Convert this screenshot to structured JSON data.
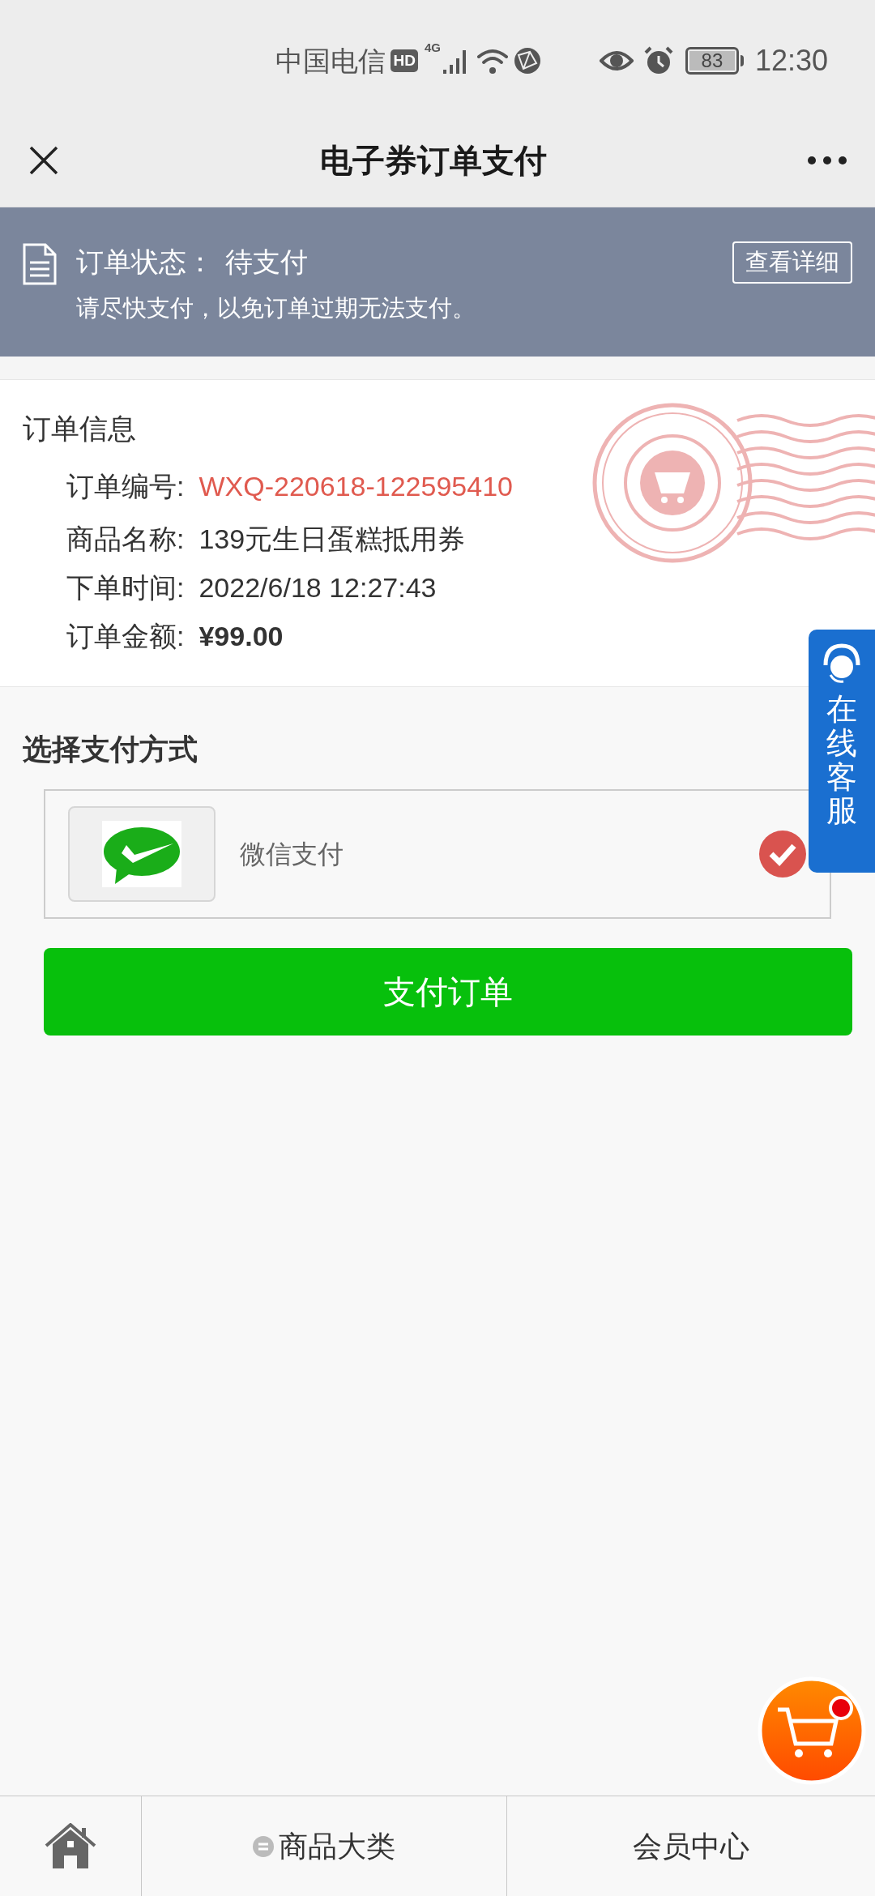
{
  "status_bar": {
    "carrier": "中国电信",
    "hd_badge": "HD",
    "network": "4G",
    "battery": "83",
    "time": "12:30"
  },
  "nav_bar": {
    "title": "电子券订单支付"
  },
  "order_banner": {
    "status_label": "订单状态：",
    "status_value": "待支付",
    "hint": "请尽快支付，以免订单过期无法支付。",
    "detail_button": "查看详细"
  },
  "order_info": {
    "title": "订单信息",
    "fields": [
      {
        "label": "订单编号:",
        "value": "WXQ-220618-122595410",
        "kind": "highlight"
      },
      {
        "label": "商品名称:",
        "value": "139元生日蛋糕抵用券",
        "kind": "plain"
      },
      {
        "label": "下单时间:",
        "value": "2022/6/18 12:27:43",
        "kind": "plain"
      },
      {
        "label": "订单金额:",
        "value": "¥99.00",
        "kind": "amount"
      }
    ]
  },
  "payment": {
    "title": "选择支付方式",
    "methods": [
      {
        "label": "微信支付",
        "selected": true
      }
    ],
    "pay_button": "支付订单"
  },
  "service_tab": {
    "label": "在线客服"
  },
  "bottom_nav": [
    {
      "kind": "home"
    },
    {
      "kind": "category",
      "label": "商品大类"
    },
    {
      "kind": "text",
      "label": "会员中心"
    }
  ]
}
